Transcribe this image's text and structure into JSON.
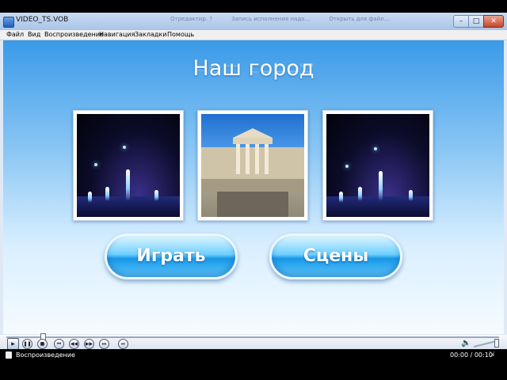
{
  "window": {
    "title": "VIDEO_TS.VOB",
    "ghost_tabs": [
      "Отредактир. ?",
      "Запись исполнения надо...",
      "Открыть для файл..."
    ],
    "controls": {
      "minimize": "–",
      "maximize": "□",
      "close": "✕"
    }
  },
  "menubar": {
    "items": [
      "Файл",
      "Вид",
      "Воспроизведение",
      "Навигация",
      "Закладки",
      "Помощь"
    ]
  },
  "dvd_menu": {
    "title": "Наш город",
    "play_label": "Играть",
    "scenes_label": "Сцены",
    "thumbnails": [
      "fountain-night-photo",
      "building-columns-photo",
      "fountain-night-photo"
    ]
  },
  "transport": {
    "play_icon": "▶",
    "pause_icon": "❚❚",
    "stop_icon": "■",
    "prev_icon": "⏮",
    "rew_icon": "◀◀",
    "fwd_icon": "▶▶",
    "next_icon": "⏭",
    "frame_icon": "⏯",
    "volume_icon": "🔈",
    "seek_fraction": 0.07
  },
  "status": {
    "text": "Воспроизведение",
    "time": "00:00 / 00:10",
    "sep": "⇲"
  },
  "colors": {
    "accent": "#1697e6",
    "background_top": "#3a9ae8"
  }
}
